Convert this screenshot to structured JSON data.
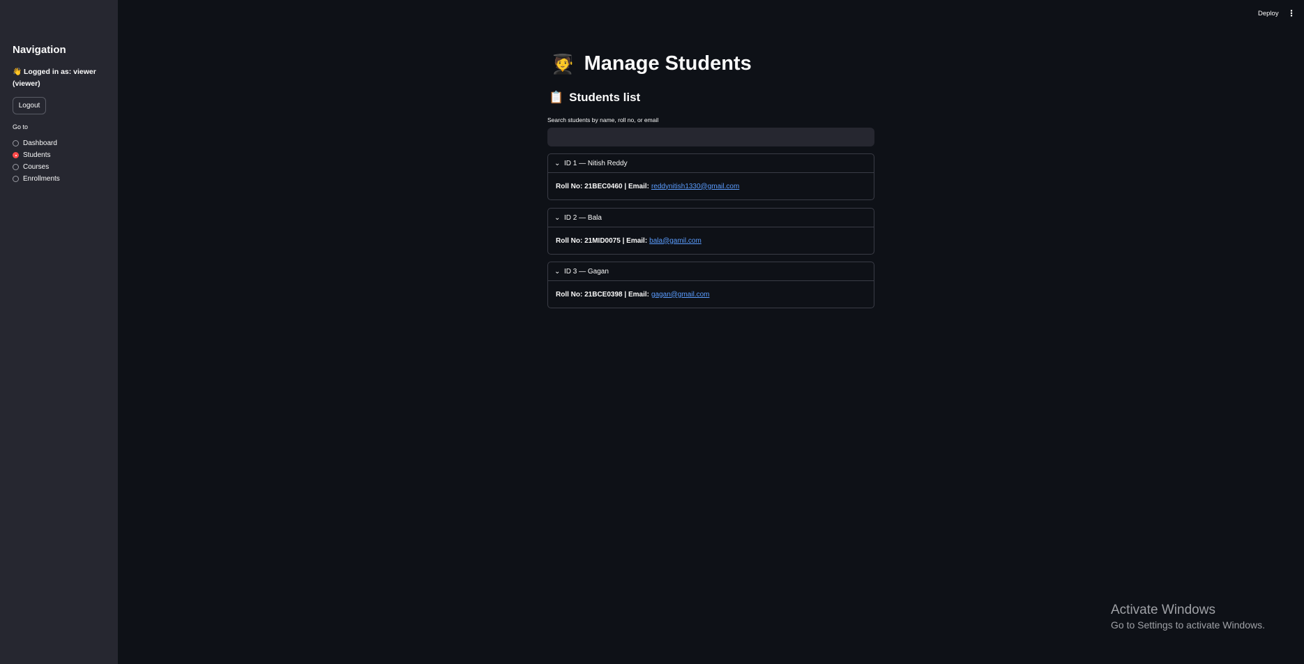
{
  "sidebar": {
    "title": "Navigation",
    "login_prefix": "👋 Logged in as: ",
    "login_user": "viewer",
    "login_role": "(viewer)",
    "logout_label": "Logout",
    "goto_label": "Go to",
    "radio_items": [
      {
        "label": "Dashboard",
        "selected": false
      },
      {
        "label": "Students",
        "selected": true
      },
      {
        "label": "Courses",
        "selected": false
      },
      {
        "label": "Enrollments",
        "selected": false
      }
    ]
  },
  "header": {
    "deploy_label": "Deploy",
    "menu_icon": "⋮"
  },
  "main": {
    "title_icon": "🧑‍🎓",
    "title": "Manage Students",
    "section_icon": "📋",
    "section_title": "Students list",
    "search_label": "Search students by name, roll no, or email",
    "search_value": "",
    "students": [
      {
        "header": "ID 1 — Nitish Reddy",
        "roll_text": "Roll No: 21BEC0460 | Email:",
        "email": "reddynitish1330@gmail.com"
      },
      {
        "header": "ID 2 — Bala",
        "roll_text": "Roll No: 21MID0075 | Email:",
        "email": "bala@gamil.com"
      },
      {
        "header": "ID 3 — Gagan",
        "roll_text": "Roll No: 21BCE0398 | Email:",
        "email": "gagan@gmail.com"
      }
    ]
  },
  "watermark": {
    "line1": "Activate Windows",
    "line2": "Go to Settings to activate Windows."
  },
  "colors": {
    "background": "#0e1117",
    "sidebar": "#262730",
    "accent": "#ff4b4b",
    "link": "#5b9dff"
  }
}
